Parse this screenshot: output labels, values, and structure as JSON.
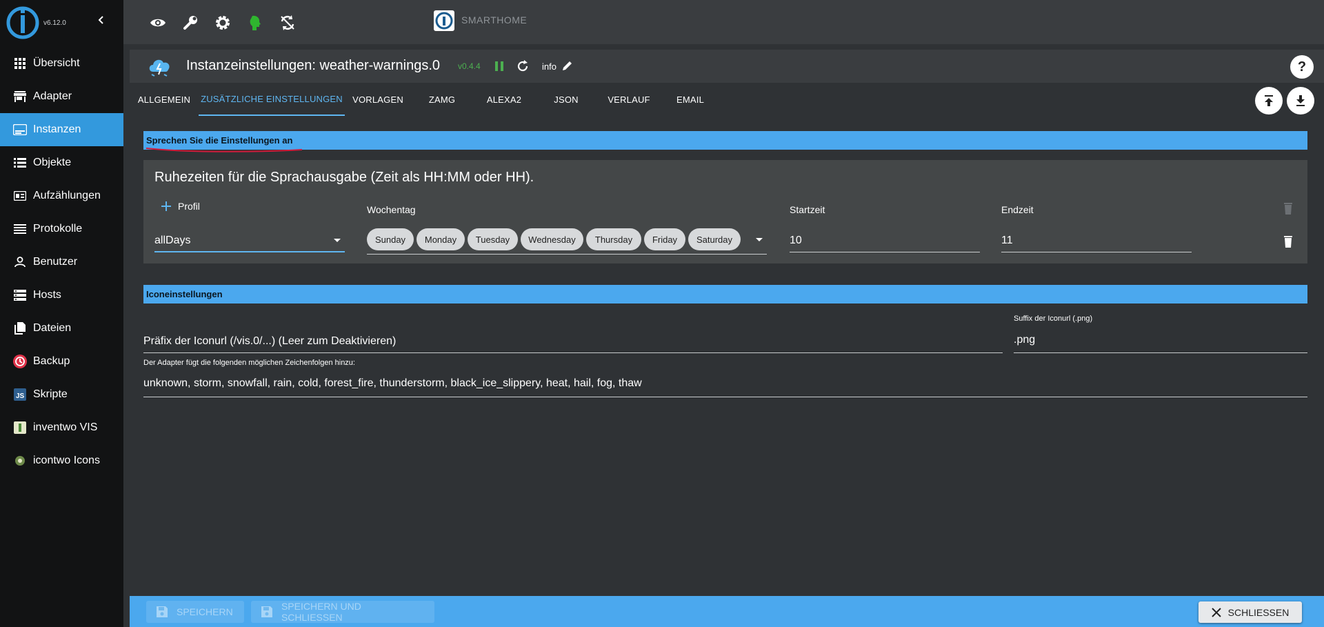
{
  "sidebar": {
    "version": "v6.12.0",
    "items": [
      {
        "label": "Übersicht",
        "icon": "grid-icon"
      },
      {
        "label": "Adapter",
        "icon": "store-icon"
      },
      {
        "label": "Instanzen",
        "icon": "instances-icon",
        "active": true
      },
      {
        "label": "Objekte",
        "icon": "list-icon"
      },
      {
        "label": "Aufzählungen",
        "icon": "enum-icon"
      },
      {
        "label": "Protokolle",
        "icon": "log-icon"
      },
      {
        "label": "Benutzer",
        "icon": "user-icon"
      },
      {
        "label": "Hosts",
        "icon": "hosts-icon"
      },
      {
        "label": "Dateien",
        "icon": "files-icon"
      },
      {
        "label": "Backup",
        "icon": "backup-icon"
      },
      {
        "label": "Skripte",
        "icon": "js-icon"
      },
      {
        "label": "inventwo VIS",
        "icon": "inventwo-icon"
      },
      {
        "label": "icontwo Icons",
        "icon": "icontwo-icon"
      }
    ]
  },
  "topbar": {
    "brand": "SMARTHOME",
    "icons": [
      "eye-icon",
      "wrench-icon",
      "gear-icon",
      "expert-mode-icon",
      "refresh-arrows-icon"
    ]
  },
  "dialog": {
    "title": "Instanzeinstellungen: weather-warnings.0",
    "version": "v0.4.4",
    "info_label": "info",
    "tabs": [
      "ALLGEMEIN",
      "ZUSÄTZLICHE EINSTELLUNGEN",
      "VORLAGEN",
      "ZAMG",
      "ALEXA2",
      "JSON",
      "VERLAUF",
      "EMAIL"
    ],
    "active_tab": 1
  },
  "speech": {
    "section_title": "Sprechen Sie die Einstellungen an",
    "panel_title": "Ruhezeiten für die Sprachausgabe (Zeit als HH:MM oder HH).",
    "columns": {
      "profile": "Profil",
      "weekday": "Wochentag",
      "start": "Startzeit",
      "end": "Endzeit"
    },
    "row": {
      "profile": "allDays",
      "days": [
        "Sunday",
        "Monday",
        "Tuesday",
        "Wednesday",
        "Thursday",
        "Friday",
        "Saturday"
      ],
      "start": "10",
      "end": "11"
    }
  },
  "icons": {
    "section_title": "Iconeinstellungen",
    "prefix_placeholder": "Präfix der Iconurl (/vis.0/...) (Leer zum Deaktivieren)",
    "suffix_label": "Suffix der Iconurl (.png)",
    "suffix_value": ".png",
    "strings_label": "Der Adapter fügt die folgenden möglichen Zeichenfolgen hinzu:",
    "strings_value": "unknown, storm, snowfall, rain, cold, forest_fire, thunderstorm, black_ice_slippery, heat, hail, fog, thaw"
  },
  "footer": {
    "save": "SPEICHERN",
    "save_close": "SPEICHERN UND SCHLIESSEN",
    "close": "SCHLIESSEN"
  },
  "colors": {
    "accent": "#3399dd",
    "section": "#4ba8ee",
    "version_green": "#4caf50"
  }
}
